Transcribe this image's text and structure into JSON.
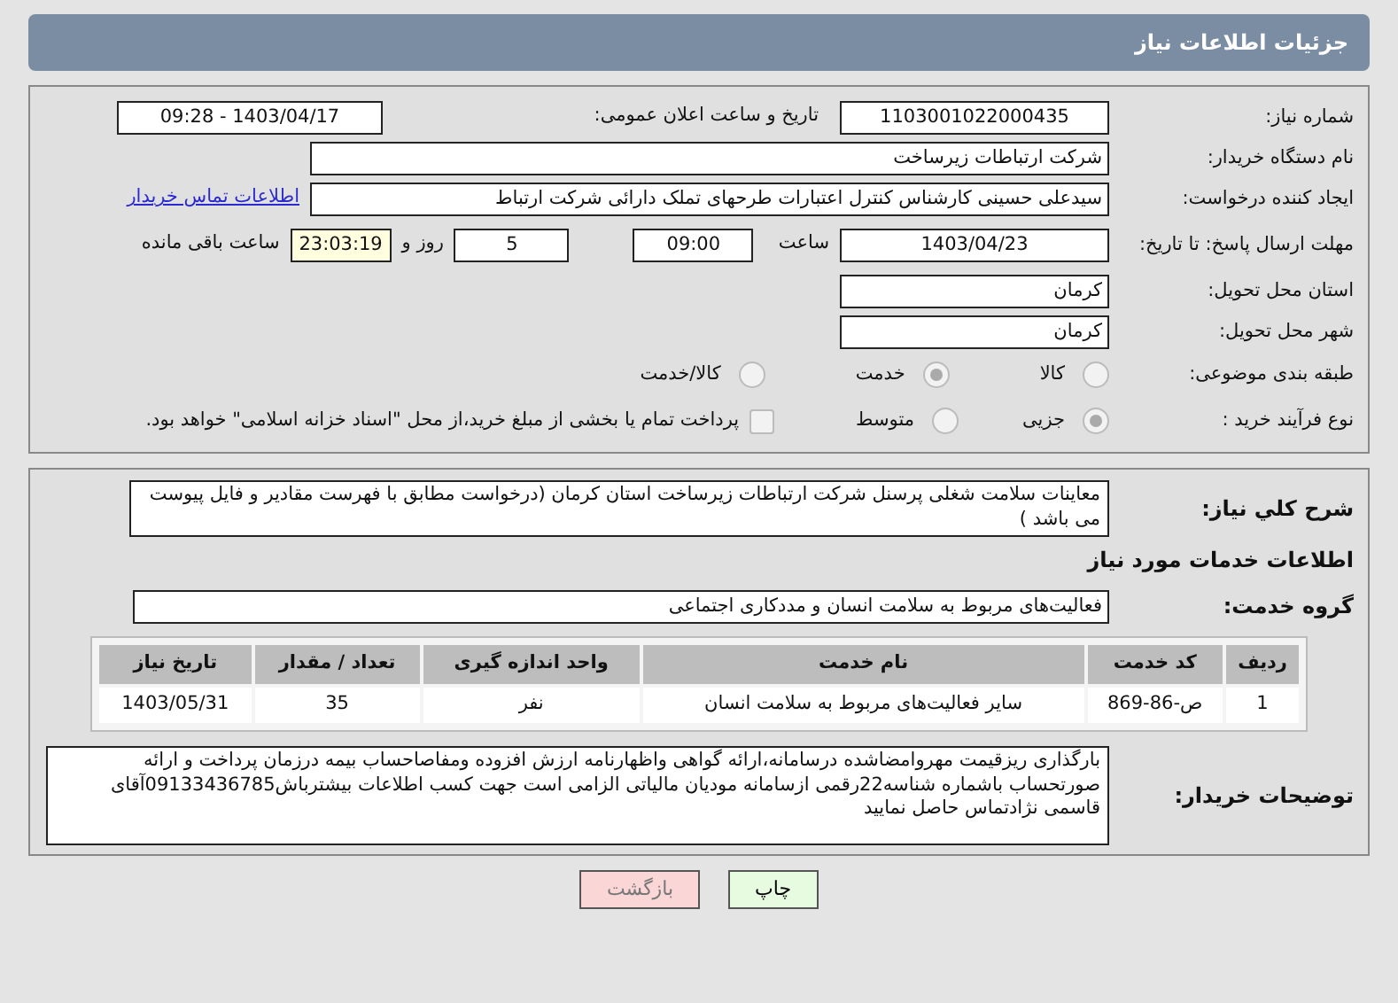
{
  "page_title": "جزئیات اطلاعات نیاز",
  "need_number": {
    "label": "شماره نیاز:",
    "value": "1103001022000435"
  },
  "announce": {
    "label": "تاریخ و ساعت اعلان عمومی:",
    "value": "1403/04/17 - 09:28"
  },
  "buyer_org": {
    "label": "نام دستگاه خریدار:",
    "value": "شرکت ارتباطات زیرساخت"
  },
  "requester": {
    "label": "ایجاد کننده درخواست:",
    "value": "سیدعلی حسینی کارشناس کنترل اعتبارات طرحهای تملک دارائی شرکت ارتباط",
    "link": "اطلاعات تماس خریدار"
  },
  "deadline": {
    "label": "مهلت ارسال پاسخ: تا تاریخ:",
    "date": "1403/04/23",
    "time_label": "ساعت",
    "time": "09:00",
    "days": "5",
    "days_label": "روز و",
    "remaining": "23:03:19",
    "remaining_label": "ساعت باقی مانده"
  },
  "province": {
    "label": "استان محل تحویل:",
    "value": "کرمان"
  },
  "city": {
    "label": "شهر محل تحویل:",
    "value": "کرمان"
  },
  "category": {
    "label": "طبقه بندی موضوعی:",
    "options": [
      {
        "label": "کالا",
        "selected": false
      },
      {
        "label": "خدمت",
        "selected": true
      },
      {
        "label": "کالا/خدمت",
        "selected": false
      }
    ]
  },
  "process": {
    "label": "نوع فرآیند خرید :",
    "options": [
      {
        "label": "جزیی",
        "selected": true
      },
      {
        "label": "متوسط",
        "selected": false
      }
    ],
    "payment": {
      "label": "پرداخت تمام یا بخشی از مبلغ خرید،از محل \"اسناد خزانه اسلامی\" خواهد بود.",
      "checked": false
    }
  },
  "description": {
    "label": "شرح كلي نیاز:",
    "value": "معاینات سلامت شغلی پرسنل شرکت ارتباطات زیرساخت استان کرمان (درخواست مطابق با فهرست مقادیر و فایل پیوست می باشد )"
  },
  "services_title": "اطلاعات خدمات مورد نیاز",
  "service_group": {
    "label": "گروه خدمت:",
    "value": "فعالیت‌های مربوط به سلامت انسان و مددکاری اجتماعی"
  },
  "table": {
    "columns": [
      "ردیف",
      "کد خدمت",
      "نام خدمت",
      "واحد اندازه گیری",
      "تعداد / مقدار",
      "تاریخ نیاز"
    ],
    "rows": [
      [
        "1",
        "ص-86-869",
        "سایر فعالیت‌های مربوط به سلامت انسان",
        "نفر",
        "35",
        "1403/05/31"
      ]
    ]
  },
  "buyer_notes": {
    "label": "توضیحات خریدار:",
    "value": "بارگذاری ریزقیمت مهروامضاشده درسامانه،ارائه گواهی واظهارنامه ارزش افزوده ومفاصاحساب بیمه درزمان پرداخت و ارائه صورتحساب باشماره شناسه22رقمی ازسامانه مودیان مالیاتی الزامی است جهت کسب اطلاعات بیشترباش09133436785آقای قاسمی نژادتماس حاصل نمایید"
  },
  "buttons": [
    {
      "label": "چاپ",
      "kind": "print"
    },
    {
      "label": "بازگشت",
      "kind": "back"
    }
  ]
}
